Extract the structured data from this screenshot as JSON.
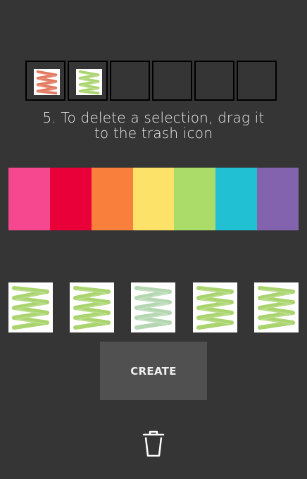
{
  "instruction": {
    "line1": "5. To delete a selection, drag it",
    "line2": "to the trash icon"
  },
  "selection_slots": [
    {
      "filled": true,
      "pattern_color": "#e0795f"
    },
    {
      "filled": true,
      "pattern_color": "#a9d46e"
    },
    {
      "filled": false
    },
    {
      "filled": false
    },
    {
      "filled": false
    },
    {
      "filled": false
    }
  ],
  "palette": [
    "#f5488f",
    "#ea0038",
    "#f9803c",
    "#fde26a",
    "#abdb68",
    "#22c0d3",
    "#8363ae"
  ],
  "patterns": [
    {
      "color": "#a9d46e",
      "icon": "zigzag-spring"
    },
    {
      "color": "#a9d46e",
      "icon": "zigzag-spring"
    },
    {
      "color": "#b4d7b1",
      "icon": "zigzag-spring"
    },
    {
      "color": "#a9d46e",
      "icon": "zigzag-spring"
    },
    {
      "color": "#a9d46e",
      "icon": "zigzag-spring"
    }
  ],
  "create_button": {
    "label": "CREATE"
  },
  "trash": {
    "icon": "trash-icon"
  }
}
